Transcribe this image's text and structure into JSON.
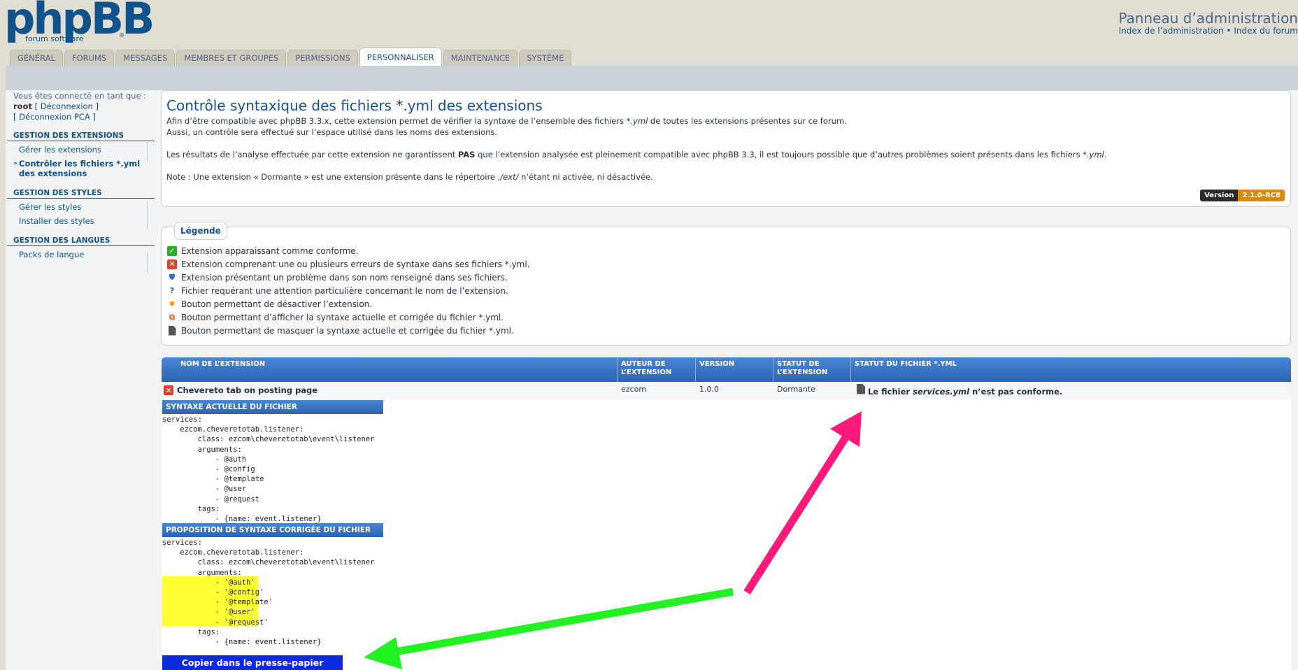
{
  "header": {
    "logo_text": "phpBB",
    "logo_sub": "forum software",
    "logo_reg": "®",
    "panel_title": "Panneau d’administration",
    "link_admin_index": "Index de l’administration",
    "link_separator": " • ",
    "link_forum_index": "Index du forum"
  },
  "tabs": [
    {
      "label": "Général"
    },
    {
      "label": "Forums"
    },
    {
      "label": "Messages"
    },
    {
      "label": "Membres et groupes"
    },
    {
      "label": "Permissions"
    },
    {
      "label": "Personnaliser"
    },
    {
      "label": "Maintenance"
    },
    {
      "label": "Système"
    }
  ],
  "sidebar": {
    "login_prefix": "Vous êtes connecté en tant que :",
    "username": "root",
    "logout": "[ Déconnexion ]",
    "logout_acp": "[ Déconnexion PCA ]",
    "sections": [
      {
        "title": "Gestion des extensions",
        "items": [
          "Gérer les extensions",
          "Contrôler les fichiers *.yml des extensions"
        ]
      },
      {
        "title": "Gestion des styles",
        "items": [
          "Gérer les styles",
          "Installer des styles"
        ]
      },
      {
        "title": "Gestion des langues",
        "items": [
          "Packs de langue"
        ]
      }
    ]
  },
  "intro": {
    "title": "Contrôle syntaxique des fichiers *.yml des extensions",
    "p1a": "Afin d’être compatible avec phpBB 3.3.x, cette extension permet de vérifier la syntaxe de l’ensemble des fichiers ",
    "p1b": "*.yml",
    "p1c": " de toutes les extensions présentes sur ce forum.",
    "p2": "Aussi, un contrôle sera effectué sur l’espace utilisé dans les noms des extensions.",
    "p3a": "Les résultats de l’analyse effectuée par cette extension ne garantissent ",
    "p3b": "PAS",
    "p3c": " que l’extension analysée est pleinement compatible avec phpBB 3.3, il est toujours possible que d’autres problèmes soient présents dans les fichiers ",
    "p3d": "*.yml",
    "p3e": ".",
    "p4a": "Note : Une extension « Dormante » est une extension présente dans le répertoire ",
    "p4b": "./ext/",
    "p4c": " n’étant ni activée, ni désactivée.",
    "version_key": "Version",
    "version_value": "2.1.0-RC8"
  },
  "legend": {
    "title": "Légende",
    "items": [
      {
        "icon": "check-icon",
        "text": "Extension apparaissant comme conforme."
      },
      {
        "icon": "error-icon",
        "text": "Extension comprenant une ou plusieurs erreurs de syntaxe dans ses fichiers *.yml."
      },
      {
        "icon": "shield-icon",
        "text": "Extension présentant un problème dans son nom renseigné dans ses fichiers."
      },
      {
        "icon": "question-icon",
        "text": "Fichier requérant une attention particulière concernant le nom de l’extension."
      },
      {
        "icon": "gear-icon",
        "text": "Bouton permettant de désactiver l’extension."
      },
      {
        "icon": "copy-icon",
        "text": "Bouton permettant d’afficher la syntaxe actuelle et corrigée du fichier *.yml."
      },
      {
        "icon": "document-icon",
        "text": "Bouton permettant de masquer la syntaxe actuelle et corrigée du fichier *.yml."
      }
    ]
  },
  "table": {
    "headers": {
      "name": "Nom de l’extension",
      "author": "Auteur de l’extension",
      "version": "Version",
      "ext_status": "Statut de l’extension",
      "file_status": "Statut du fichier *.yml"
    },
    "row": {
      "name": "Chevereto tab on posting page",
      "author": "ezcom",
      "version": "1.0.0",
      "status": "Dormante",
      "file_msg_a": "Le fichier ",
      "file_msg_b": "services.yml",
      "file_msg_c": " n’est pas conforme."
    }
  },
  "syntax": {
    "current_label": "Syntaxe actuelle du fichier",
    "current_code": "services:\n    ezcom.cheveretotab.listener:\n        class: ezcom\\cheveretotab\\event\\listener\n        arguments:\n            - @auth\n            - @config\n            - @template\n            - @user\n            - @request\n        tags:\n            - {name: event.listener}",
    "proposed_label": "Proposition de syntaxe corrigée du fichier",
    "proposed_code": "services:\n    ezcom.cheveretotab.listener:\n        class: ezcom\\cheveretotab\\event\\listener\n        arguments:\n            - '@auth'\n            - '@config'\n            - '@template'\n            - '@user'\n            - '@request'\n        tags:\n            - {name: event.listener}",
    "copy_button": "Copier dans le presse-papier"
  },
  "colors": {
    "arrow_magenta": "#ff1a7a",
    "arrow_green": "#22f222",
    "highlight": "#ffff33",
    "copy_button_bg": "#0c2bdc"
  }
}
